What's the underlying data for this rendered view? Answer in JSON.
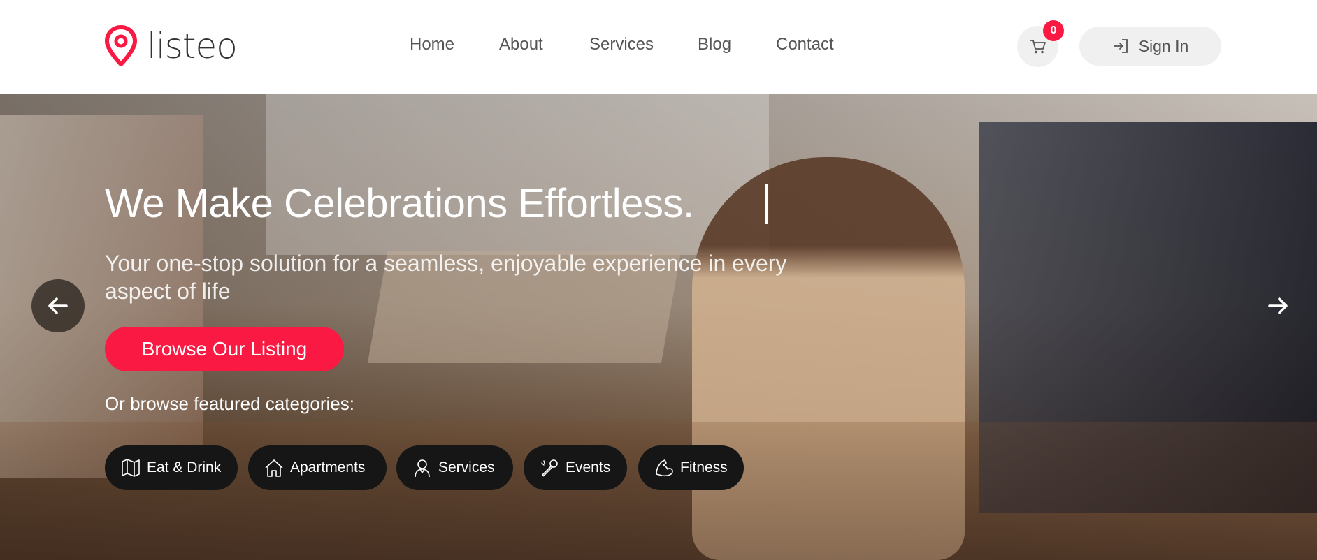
{
  "brand": {
    "name": "listeo",
    "accent": "#f91942"
  },
  "nav": {
    "items": [
      {
        "label": "Home"
      },
      {
        "label": "About"
      },
      {
        "label": "Services"
      },
      {
        "label": "Blog"
      },
      {
        "label": "Contact"
      }
    ]
  },
  "cart": {
    "count": "0",
    "icon": "cart-icon"
  },
  "signin": {
    "label": "Sign In",
    "icon": "sign-in-icon"
  },
  "hero": {
    "title": "We Make Celebrations Effortless.",
    "subtitle": "Your one-stop solution for a seamless, enjoyable experience in every aspect of life",
    "cta_label": "Browse Our Listing",
    "categories_label": "Or browse featured categories:",
    "categories": [
      {
        "label": "Eat & Drink",
        "icon": "map-icon"
      },
      {
        "label": "Apartments",
        "icon": "home-icon"
      },
      {
        "label": "Services",
        "icon": "person-icon"
      },
      {
        "label": "Events",
        "icon": "microphone-icon"
      },
      {
        "label": "Fitness",
        "icon": "muscle-icon"
      }
    ]
  }
}
